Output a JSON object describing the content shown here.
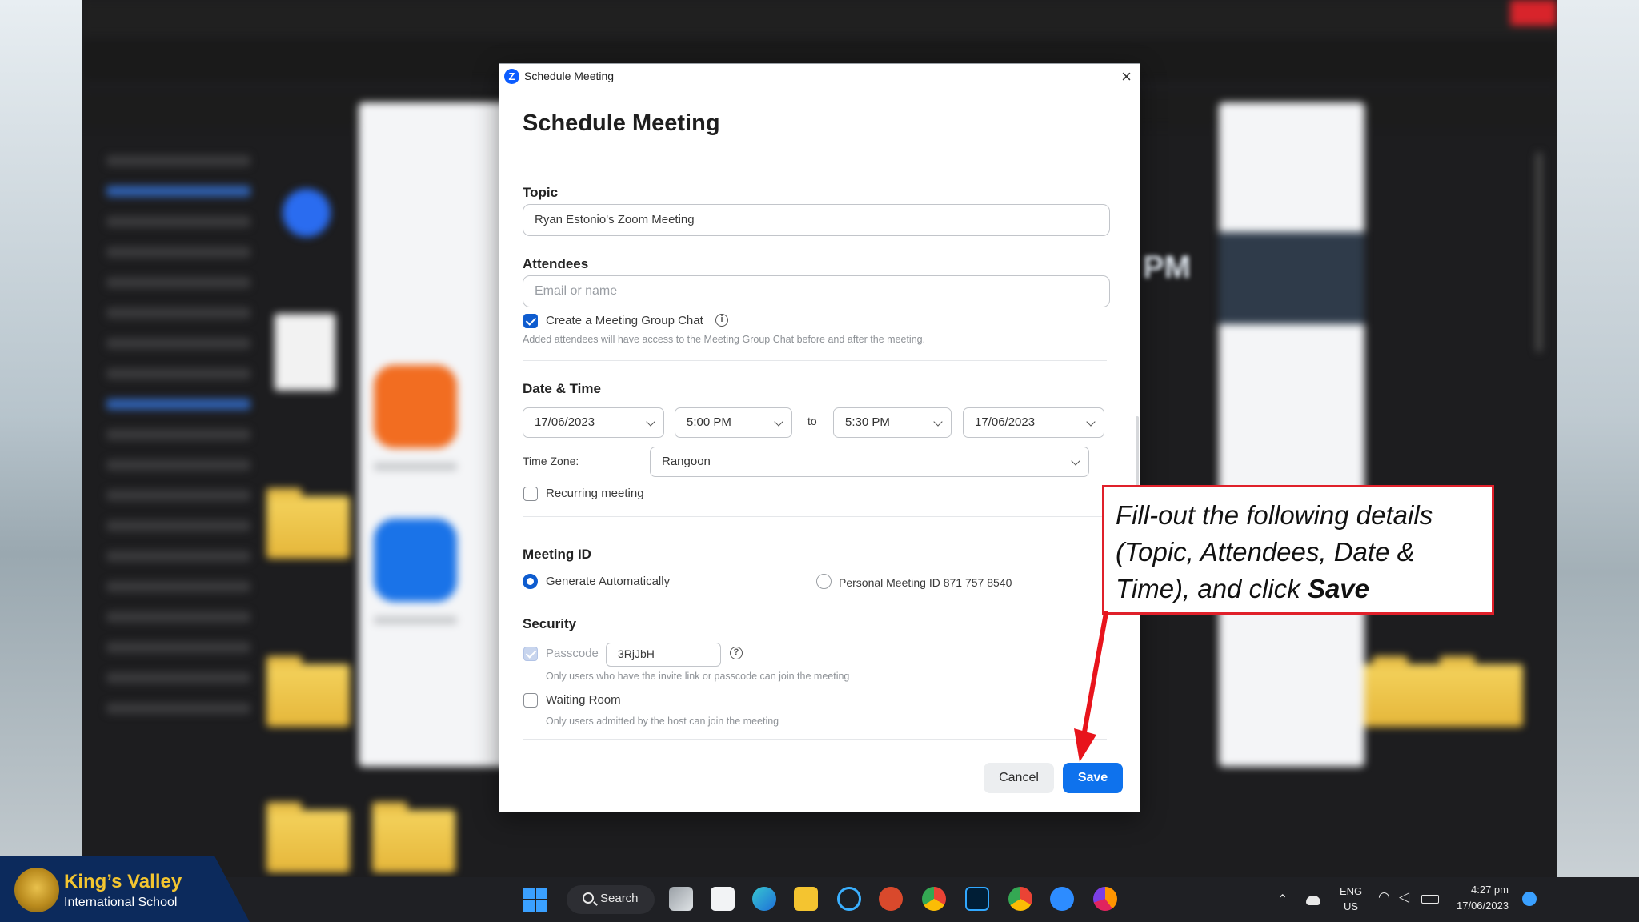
{
  "dialog": {
    "window_title": "Schedule Meeting",
    "close_glyph": "×",
    "heading": "Schedule Meeting",
    "topic": {
      "label": "Topic",
      "value": "Ryan Estonio's Zoom Meeting"
    },
    "attendees": {
      "label": "Attendees",
      "placeholder": "Email or name",
      "group_chat_label": "Create a Meeting Group Chat",
      "group_chat_checked": true,
      "group_chat_hint": "Added attendees will have access to the Meeting Group Chat before and after the meeting."
    },
    "date_time": {
      "label": "Date & Time",
      "start_date": "17/06/2023",
      "start_time": "5:00 PM",
      "to_label": "to",
      "end_time": "5:30 PM",
      "end_date": "17/06/2023",
      "timezone_label": "Time Zone:",
      "timezone": "Rangoon",
      "recurring_label": "Recurring meeting",
      "recurring_checked": false
    },
    "meeting_id": {
      "label": "Meeting ID",
      "option_auto": "Generate Automatically",
      "option_personal": "Personal Meeting ID 871 757 8540",
      "selected": "Generate Automatically"
    },
    "security": {
      "label": "Security",
      "passcode_label": "Passcode",
      "passcode_value": "3RjJbH",
      "passcode_hint": "Only users who have the invite link or passcode can join the meeting",
      "waiting_room_label": "Waiting Room",
      "waiting_room_hint": "Only users admitted by the host can join the meeting"
    },
    "buttons": {
      "cancel": "Cancel",
      "save": "Save"
    }
  },
  "callout": {
    "text_before": "Fill-out the following details (Topic, Attendees, Date & Time), and click ",
    "text_bold": "Save",
    "border_color": "#e0202a"
  },
  "background": {
    "zoom_partial_text": "PM"
  },
  "branding": {
    "name": "King’s Valley",
    "subtitle": "International School",
    "name_color": "#f3c530",
    "bg_color": "#0c2a5c"
  },
  "taskbar": {
    "search_label": "Search",
    "lang_line1": "ENG",
    "lang_line2": "US",
    "time": "4:27 pm",
    "date": "17/06/2023",
    "icons": [
      "windows-start-icon",
      "search-icon",
      "task-view-icon",
      "store-icon",
      "edge-icon",
      "file-explorer-icon",
      "cortana-icon",
      "powerpoint-icon",
      "chrome-icon",
      "photoshop-icon",
      "chrome-icon",
      "zoom-icon",
      "firefox-icon"
    ]
  },
  "colors": {
    "accent": "#0e72ed",
    "checkbox": "#0e5ccf"
  }
}
